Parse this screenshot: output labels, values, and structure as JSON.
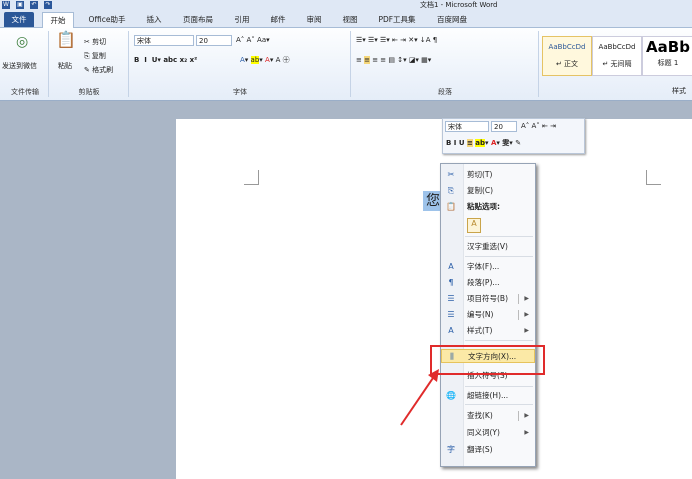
{
  "titlebar": {
    "title": "文档1 - Microsoft Word",
    "qat_icons": [
      "word-logo-icon",
      "save-icon",
      "undo-icon",
      "redo-icon",
      "customize-icon"
    ]
  },
  "tabs": [
    "文件",
    "开始",
    "Office助手",
    "插入",
    "页面布局",
    "引用",
    "邮件",
    "审阅",
    "视图",
    "PDF工具集",
    "百度网盘"
  ],
  "ribbon": {
    "send_wechat": "发送到微信",
    "file_transfer": "文件传输",
    "paste": "粘贴",
    "cut": "剪切",
    "copy": "复制",
    "format_painter": "格式刷",
    "clipboard": "剪贴板",
    "font_name": "宋体",
    "font_size": "20",
    "font_group": "字体",
    "paragraph_group": "段落",
    "styles": [
      {
        "preview": "AaBbCcDd",
        "name": "↵ 正文"
      },
      {
        "preview": "AaBbCcDd",
        "name": "↵ 无间隔"
      },
      {
        "preview": "AaBb",
        "name": "标题 1"
      }
    ],
    "styles_group": "样式"
  },
  "document": {
    "selected_text": "您"
  },
  "mini_toolbar": {
    "font": "宋体",
    "size": "20"
  },
  "context_menu": {
    "items": [
      {
        "icon": "✂",
        "label": "剪切(T)"
      },
      {
        "icon": "⎘",
        "label": "复制(C)"
      },
      {
        "icon": "📋",
        "label": "粘贴选项:"
      },
      {
        "icon": "",
        "label": ""
      },
      {
        "icon": "",
        "label": "汉字重选(V)"
      },
      {
        "icon": "A",
        "label": "字体(F)..."
      },
      {
        "icon": "¶",
        "label": "段落(P)..."
      },
      {
        "icon": "☰",
        "label": "项目符号(B)"
      },
      {
        "icon": "☰",
        "label": "编号(N)"
      },
      {
        "icon": "A",
        "label": "样式(T)"
      },
      {
        "icon": "⫼",
        "label": "文字方向(X)..."
      },
      {
        "icon": "",
        "label": "插入符号(S)"
      },
      {
        "icon": "🌐",
        "label": "超链接(H)..."
      },
      {
        "icon": "",
        "label": "查找(K)"
      },
      {
        "icon": "",
        "label": "同义词(Y)"
      },
      {
        "icon": "字",
        "label": "翻译(S)"
      }
    ]
  },
  "colors": {
    "accent": "#2b5797",
    "highlight": "#fbe9a6",
    "annotation": "#e02b2b"
  }
}
